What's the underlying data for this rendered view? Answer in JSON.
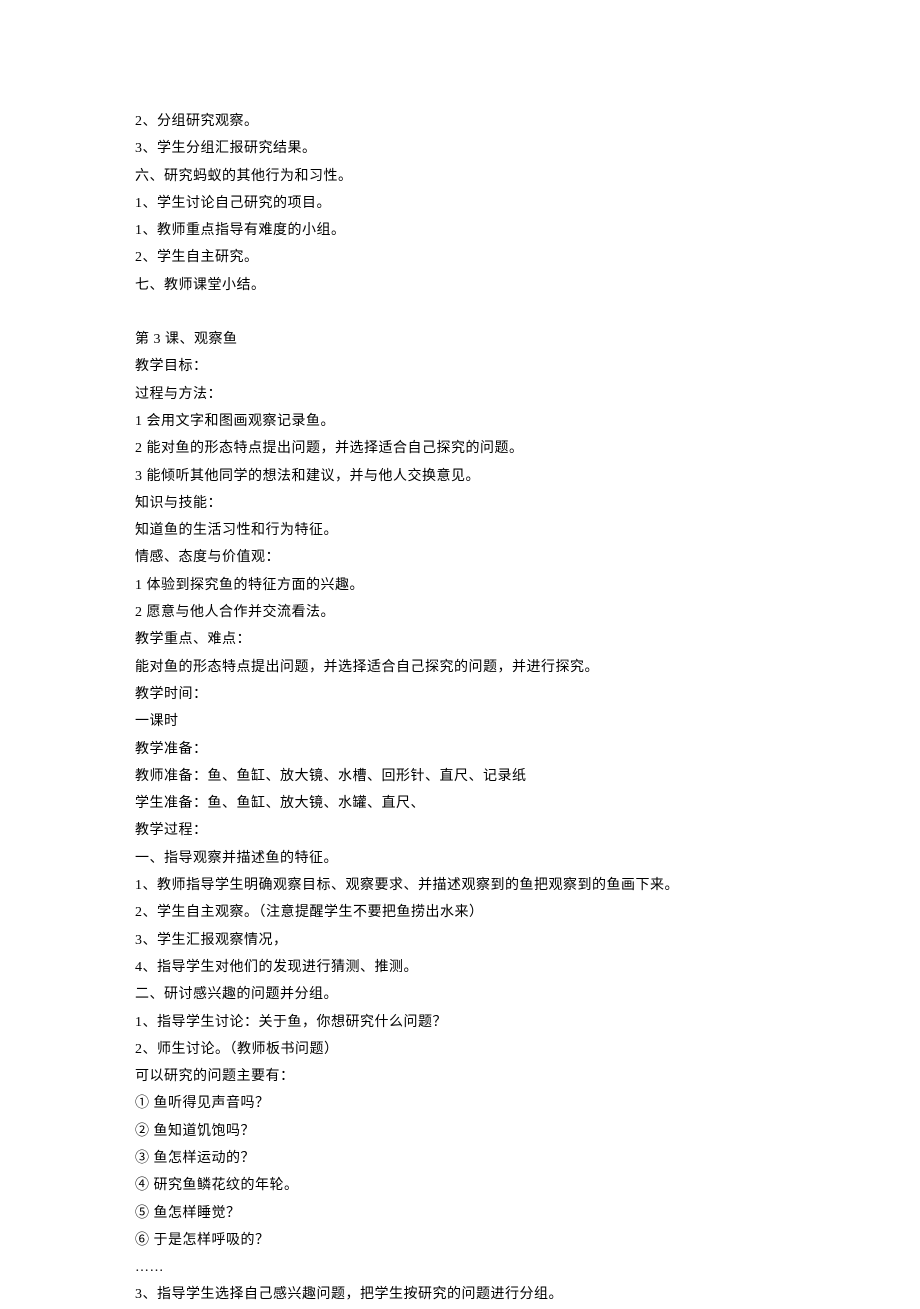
{
  "lines": [
    "2、分组研究观察。",
    "3、学生分组汇报研究结果。",
    "六、研究蚂蚁的其他行为和习性。",
    "1、学生讨论自己研究的项目。",
    "1、教师重点指导有难度的小组。",
    "2、学生自主研究。",
    "七、教师课堂小结。",
    "",
    "第 3 课、观察鱼",
    "教学目标：",
    "过程与方法：",
    "1 会用文字和图画观察记录鱼。",
    "2 能对鱼的形态特点提出问题，并选择适合自己探究的问题。",
    "3 能倾听其他同学的想法和建议，并与他人交换意见。",
    "知识与技能：",
    "知道鱼的生活习性和行为特征。",
    "情感、态度与价值观：",
    "1 体验到探究鱼的特征方面的兴趣。",
    "2 愿意与他人合作并交流看法。",
    "教学重点、难点：",
    "能对鱼的形态特点提出问题，并选择适合自己探究的问题，并进行探究。",
    "教学时间：",
    "一课时",
    "教学准备：",
    "教师准备：鱼、鱼缸、放大镜、水槽、回形针、直尺、记录纸",
    "学生准备：鱼、鱼缸、放大镜、水罐、直尺、",
    "教学过程：",
    "一、指导观察并描述鱼的特征。",
    "1、教师指导学生明确观察目标、观察要求、并描述观察到的鱼把观察到的鱼画下来。",
    "2、学生自主观察。（注意提醒学生不要把鱼捞出水来）",
    "3、学生汇报观察情况，",
    "4、指导学生对他们的发现进行猜测、推测。",
    "二、研讨感兴趣的问题并分组。",
    "1、指导学生讨论：关于鱼，你想研究什么问题？",
    "2、师生讨论。（教师板书问题）",
    "可以研究的问题主要有：",
    "① 鱼听得见声音吗？",
    "② 鱼知道饥饱吗？",
    "③ 鱼怎样运动的？",
    "④ 研究鱼鳞花纹的年轮。",
    "⑤ 鱼怎样睡觉？",
    "⑥ 于是怎样呼吸的？",
    "……",
    "3、指导学生选择自己感兴趣问题，把学生按研究的问题进行分组。"
  ]
}
